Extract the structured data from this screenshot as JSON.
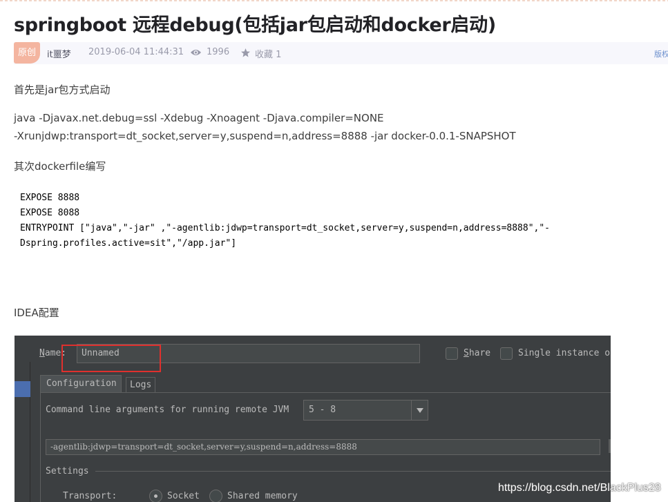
{
  "article": {
    "title": "springboot 远程debug(包括jar包启动和docker启动)",
    "badge": "原创",
    "author": "it噩梦",
    "timestamp": "2019-06-04 11:44:31",
    "views": "1996",
    "favorites": "收藏 1",
    "copyright_link": "版权"
  },
  "body": {
    "para1": "首先是jar包方式启动",
    "cmd_line1": "java -Djavax.net.debug=ssl -Xdebug -Xnoagent -Djava.compiler=NONE",
    "cmd_line2": "-Xrunjdwp:transport=dt_socket,server=y,suspend=n,address=8888 -jar docker-0.0.1-SNAPSHOT",
    "para2": "其次dockerfile编写",
    "code_lines": [
      "EXPOSE 8888",
      "EXPOSE 8088",
      "ENTRYPOINT [\"java\",\"-jar\" ,\"-agentlib:jdwp=transport=dt_socket,server=y,suspend=n,address=8888\",\"-",
      "Dspring.profiles.active=sit\",\"/app.jar\"]"
    ],
    "para3": "IDEA配置"
  },
  "ide": {
    "name_label": "Name:",
    "name_value": "Unnamed",
    "share_label": "Share",
    "single_instance_label": "Single instance o",
    "tab_configuration": "Configuration",
    "tab_logs": "Logs",
    "cmd_args_label": "Command line arguments for running remote JVM",
    "jdk_version": "5 - 8",
    "args_value": "-agentlib:jdwp=transport=dt_socket,server=y,suspend=n,address=8888",
    "settings_label": "Settings",
    "transport_label": "Transport:",
    "socket_label": "Socket",
    "shared_memory_label": "Shared memory"
  },
  "watermark": "https://blog.csdn.net/BlackPlus28",
  "colors": {
    "title": "#222226",
    "badge_bg": "#f4b5a0",
    "meta_bg": "#f7f7fc",
    "ide_bg": "#3c3f41",
    "highlight": "#e0302d"
  }
}
